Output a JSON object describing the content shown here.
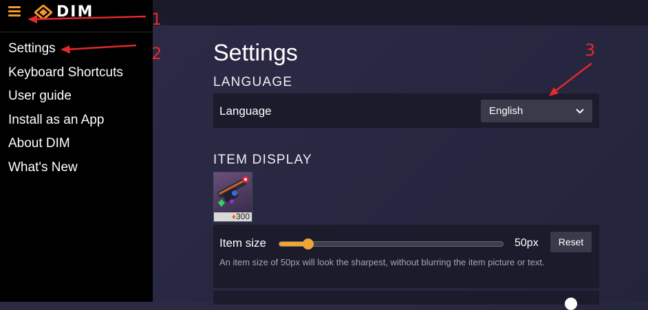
{
  "app": {
    "logo_text": "DIM"
  },
  "sidebar": {
    "items": [
      {
        "label": "Settings"
      },
      {
        "label": "Keyboard Shortcuts"
      },
      {
        "label": "User guide"
      },
      {
        "label": "Install as an App"
      },
      {
        "label": "About DIM"
      },
      {
        "label": "What's New"
      }
    ]
  },
  "settings": {
    "title": "Settings",
    "language_section": {
      "heading": "LANGUAGE",
      "label": "Language",
      "selected": "English"
    },
    "item_display": {
      "heading": "ITEM DISPLAY",
      "preview_power": "300",
      "item_size_label": "Item size",
      "item_size_value": "50px",
      "item_size_fraction": 0.13,
      "reset_label": "Reset",
      "hint": "An item size of 50px will look the sharpest, without blurring the item picture or text."
    }
  },
  "annotations": {
    "one": "1",
    "two": "2",
    "three": "3"
  },
  "colors": {
    "accent": "#f39a2d",
    "slider": "#f0a637",
    "annotation": "#e3292c"
  }
}
